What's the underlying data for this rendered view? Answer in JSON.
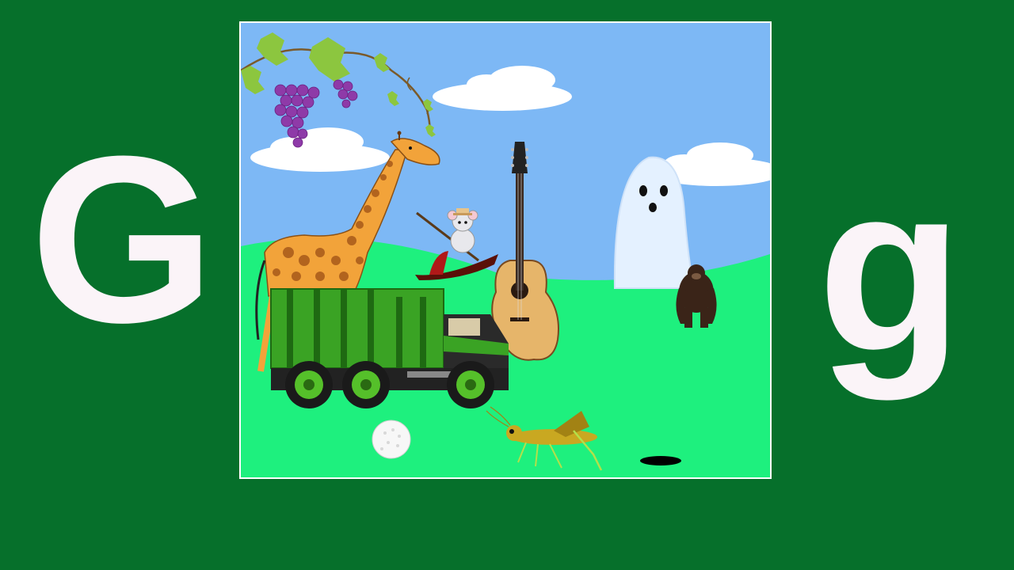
{
  "letters": {
    "uppercase": "G",
    "lowercase": "g"
  },
  "scene": {
    "objects": [
      "grapes",
      "giraffe",
      "gondola",
      "guitar",
      "garbage-truck",
      "ghost",
      "gorilla",
      "golf-ball",
      "golf-hole",
      "grasshopper",
      "clouds",
      "grass-hills"
    ]
  },
  "colors": {
    "background": "#06702b",
    "letter": "#fbf4f8",
    "sky": "#7db8f5",
    "grass": "#1ef07e",
    "frame": "#ffffff"
  }
}
